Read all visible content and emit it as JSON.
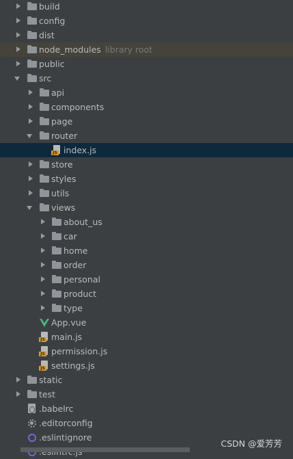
{
  "project_tree": {
    "build": "build",
    "config": "config",
    "dist": "dist",
    "node_modules": "node_modules",
    "node_modules_hint": "library root",
    "public": "public",
    "src": "src",
    "api": "api",
    "components": "components",
    "page": "page",
    "router": "router",
    "router_index": "index.js",
    "store": "store",
    "styles": "styles",
    "utils": "utils",
    "views": "views",
    "about_us": "about_us",
    "car": "car",
    "home": "home",
    "order": "order",
    "personal": "personal",
    "product": "product",
    "type": "type",
    "app_vue": "App.vue",
    "main_js": "main.js",
    "permission_js": "permission.js",
    "settings_js": "settings.js",
    "static": "static",
    "test": "test",
    "babelrc": ".babelrc",
    "editorconfig": ".editorconfig",
    "eslintignore": ".eslintignore",
    "eslintrc": ".eslintrc.js"
  },
  "icons": {
    "folder": "folder-icon",
    "js": "js-file-icon",
    "vue": "vue-file-icon",
    "babel": "babel-file-icon",
    "config": "gear-icon",
    "eslint": "eslint-icon"
  },
  "colors": {
    "background": "#3c3f41",
    "selected_row": "#0d293e",
    "library_row": "#45433a",
    "text": "#bbbbbb",
    "hint_text": "#787878"
  },
  "watermark": "CSDN @爱芳芳"
}
